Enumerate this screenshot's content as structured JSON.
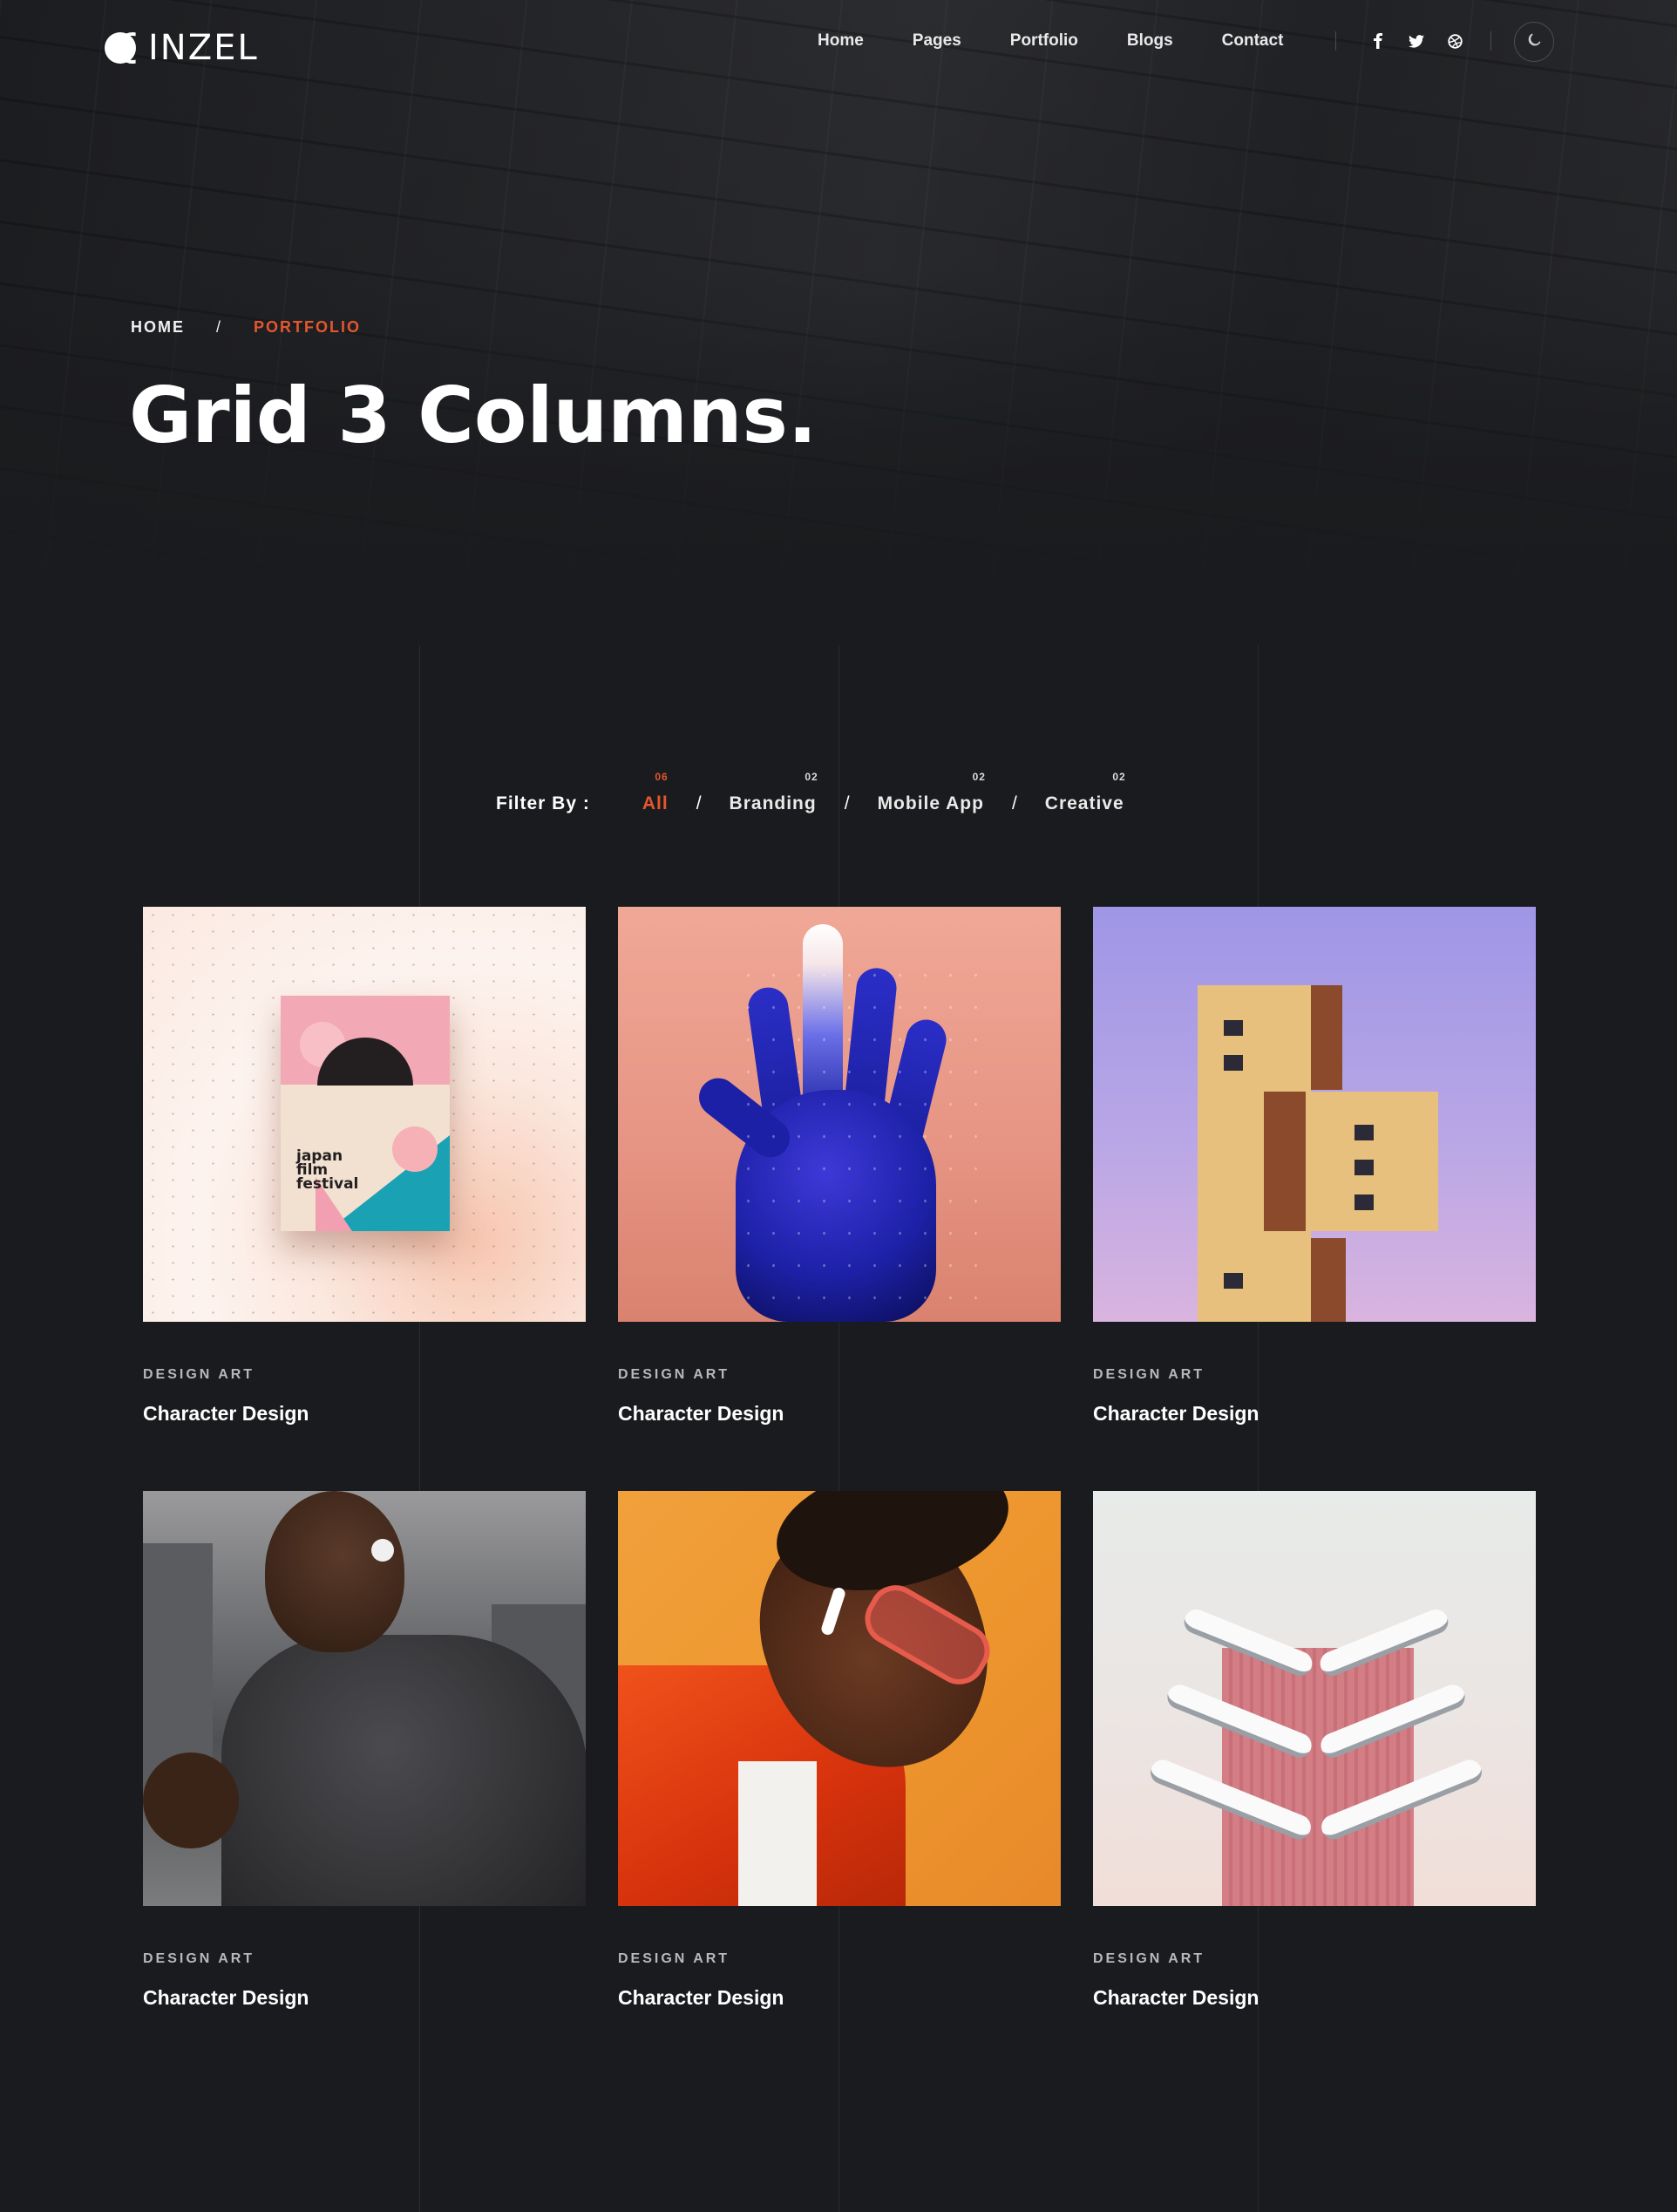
{
  "brand": {
    "logo_text": "INZEL"
  },
  "nav": {
    "links": [
      "Home",
      "Pages",
      "Portfolio",
      "Blogs",
      "Contact"
    ],
    "socials": [
      "facebook-icon",
      "twitter-icon",
      "dribbble-icon"
    ],
    "socials_glyphs": [
      "f",
      "🐦",
      "⊛"
    ],
    "mode_icon": "moon-icon"
  },
  "hero": {
    "breadcrumb_home": "HOME",
    "breadcrumb_sep": "/",
    "breadcrumb_current": "PORTFOLIO",
    "title": "Grid 3 Columns."
  },
  "filter": {
    "label": "Filter By :",
    "items": [
      {
        "label": "All",
        "count": "06",
        "active": true
      },
      {
        "label": "Branding",
        "count": "02",
        "active": false
      },
      {
        "label": "Mobile App",
        "count": "02",
        "active": false
      },
      {
        "label": "Creative",
        "count": "02",
        "active": false
      }
    ],
    "sep": "/"
  },
  "portfolio": [
    {
      "category": "DESIGN ART",
      "title": "Character Design",
      "image": "japan-film-festival-poster",
      "poster_text": "japan\nfilm\nfestival"
    },
    {
      "category": "DESIGN ART",
      "title": "Character Design",
      "image": "galaxy-hand"
    },
    {
      "category": "DESIGN ART",
      "title": "Character Design",
      "image": "building-violet-sky"
    },
    {
      "category": "DESIGN ART",
      "title": "Character Design",
      "image": "runner-athlete"
    },
    {
      "category": "DESIGN ART",
      "title": "Character Design",
      "image": "man-orange-background"
    },
    {
      "category": "DESIGN ART",
      "title": "Character Design",
      "image": "pink-tower"
    }
  ],
  "colors": {
    "accent": "#e4572e",
    "background": "#1a1b1e",
    "text": "#ffffff"
  }
}
